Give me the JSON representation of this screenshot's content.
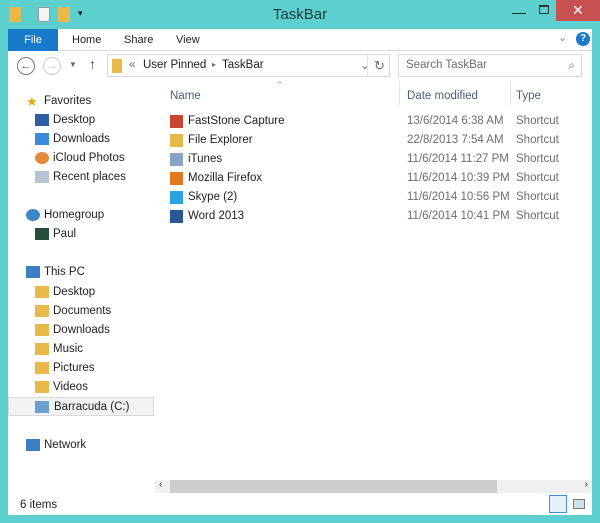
{
  "window": {
    "title": "TaskBar",
    "close": "✕",
    "minimize": "—"
  },
  "ribbon": {
    "tabs": [
      "File",
      "Home",
      "Share",
      "View"
    ],
    "help": "?"
  },
  "address": {
    "overflow": "«",
    "path": [
      "User Pinned",
      "TaskBar"
    ],
    "search_placeholder": "Search TaskBar"
  },
  "nav": {
    "favorites": {
      "label": "Favorites",
      "items": [
        "Desktop",
        "Downloads",
        "iCloud Photos",
        "Recent places"
      ]
    },
    "homegroup": {
      "label": "Homegroup",
      "items": [
        "Paul"
      ]
    },
    "thispc": {
      "label": "This PC",
      "items": [
        "Desktop",
        "Documents",
        "Downloads",
        "Music",
        "Pictures",
        "Videos",
        "Barracuda (C:)"
      ]
    },
    "network": {
      "label": "Network"
    }
  },
  "columns": {
    "name": "Name",
    "date": "Date modified",
    "type": "Type"
  },
  "files": [
    {
      "name": "FastStone Capture",
      "date": "13/6/2014 6:38 AM",
      "type": "Shortcut",
      "color": "#c8442c"
    },
    {
      "name": "File Explorer",
      "date": "22/8/2013 7:54 AM",
      "type": "Shortcut",
      "color": "#e8b84a"
    },
    {
      "name": "iTunes",
      "date": "11/6/2014 11:27 PM",
      "type": "Shortcut",
      "color": "#8aa2c8"
    },
    {
      "name": "Mozilla Firefox",
      "date": "11/6/2014 10:39 PM",
      "type": "Shortcut",
      "color": "#e07a1f"
    },
    {
      "name": "Skype (2)",
      "date": "11/6/2014 10:56 PM",
      "type": "Shortcut",
      "color": "#2aa3e0"
    },
    {
      "name": "Word 2013",
      "date": "11/6/2014 10:41 PM",
      "type": "Shortcut",
      "color": "#2b5797"
    }
  ],
  "status": {
    "count": "6 items"
  }
}
